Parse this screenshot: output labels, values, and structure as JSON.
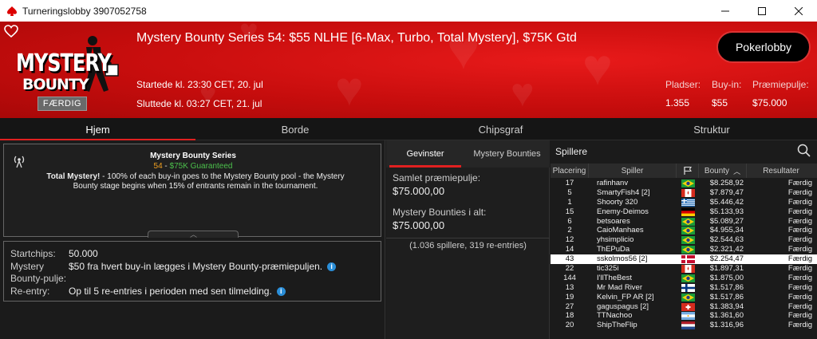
{
  "window": {
    "title": "Turneringslobby 3907052758"
  },
  "banner": {
    "logo_line1": "MYSTERY",
    "logo_line2": "BOUNTY",
    "status": "FÆRDIG",
    "title": "Mystery Bounty Series 54: $55 NLHE [6-Max, Turbo, Total Mystery], $75K Gtd",
    "started": "Startede kl. 23:30 CET, 20. jul",
    "ended": "Sluttede kl. 03:27 CET, 21. jul",
    "pokerlobby_label": "Pokerlobby",
    "stats": {
      "players_label": "Pladser:",
      "players_value": "1.355",
      "buyin_label": "Buy-in:",
      "buyin_value": "$55",
      "prize_label": "Præmiepulje:",
      "prize_value": "$75.000"
    }
  },
  "tabs": [
    {
      "label": "Hjem",
      "active": true
    },
    {
      "label": "Borde",
      "active": false
    },
    {
      "label": "Chipsgraf",
      "active": false
    },
    {
      "label": "Struktur",
      "active": false
    }
  ],
  "info": {
    "title": "Mystery Bounty Series",
    "sub_number": "54",
    "sub_sep": " - ",
    "sub_gtd": "$75K Guaranteed",
    "desc_bold": "Total Mystery!",
    "desc_rest": " - 100% of each buy-in goes to the Mystery Bounty pool - the Mystery Bounty stage begins when 15% of entrants remain in the tournament."
  },
  "details": [
    {
      "key": "Startchips:",
      "value": "50.000",
      "info": false
    },
    {
      "key": "Mystery Bounty-pulje:",
      "value": "$50 fra hvert buy-in lægges i Mystery Bounty-præmiepuljen.",
      "info": true
    },
    {
      "key": "Re-entry:",
      "value": "Op til 5 re-entries i perioden med sen tilmelding.",
      "info": true
    }
  ],
  "middle": {
    "tabs": [
      {
        "label": "Gevinster",
        "active": true
      },
      {
        "label": "Mystery Bounties",
        "active": false
      }
    ],
    "total_prize_label": "Samlet præmiepulje:",
    "total_prize_value": "$75.000,00",
    "mystery_label": "Mystery Bounties i alt:",
    "mystery_value": "$75.000,00",
    "note": "(1.036 spillere, 319 re-entries)"
  },
  "players": {
    "header": "Spillere",
    "columns": {
      "place": "Placering",
      "player": "Spiller",
      "bounty": "Bounty",
      "result": "Resultater"
    },
    "rows": [
      {
        "place": "17",
        "name": "rafinhanv",
        "flag": "br",
        "bounty": "$8.258,92",
        "result": "Færdig"
      },
      {
        "place": "5",
        "name": "SmartyFish4 [2]",
        "flag": "ca",
        "bounty": "$7.879,47",
        "result": "Færdig"
      },
      {
        "place": "1",
        "name": "Shoorty 320",
        "flag": "gr",
        "bounty": "$5.446,42",
        "result": "Færdig"
      },
      {
        "place": "15",
        "name": "Enemy-Deimos",
        "flag": "de",
        "bounty": "$5.133,93",
        "result": "Færdig"
      },
      {
        "place": "6",
        "name": "betsoares",
        "flag": "br",
        "bounty": "$5.089,27",
        "result": "Færdig"
      },
      {
        "place": "2",
        "name": "CaioManhaes",
        "flag": "br",
        "bounty": "$4.955,34",
        "result": "Færdig"
      },
      {
        "place": "12",
        "name": "yhsimplicio",
        "flag": "br",
        "bounty": "$2.544,63",
        "result": "Færdig"
      },
      {
        "place": "14",
        "name": "ThEPuDa",
        "flag": "br",
        "bounty": "$2.321,42",
        "result": "Færdig"
      },
      {
        "place": "43",
        "name": "sskolmos56 [2]",
        "flag": "dk",
        "bounty": "$2.254,47",
        "result": "Færdig",
        "highlight": true
      },
      {
        "place": "22",
        "name": "tic325i",
        "flag": "ca",
        "bounty": "$1.897,31",
        "result": "Færdig"
      },
      {
        "place": "144",
        "name": "I'llTheBest",
        "flag": "br",
        "bounty": "$1.875,00",
        "result": "Færdig"
      },
      {
        "place": "13",
        "name": "Mr Mad River",
        "flag": "fi",
        "bounty": "$1.517,86",
        "result": "Færdig"
      },
      {
        "place": "19",
        "name": "Kelvin_FP AR [2]",
        "flag": "br",
        "bounty": "$1.517,86",
        "result": "Færdig"
      },
      {
        "place": "27",
        "name": "gaguspagus [2]",
        "flag": "ch",
        "bounty": "$1.383,94",
        "result": "Færdig"
      },
      {
        "place": "18",
        "name": "TTNachoo",
        "flag": "ar",
        "bounty": "$1.361,60",
        "result": "Færdig"
      },
      {
        "place": "20",
        "name": "ShipTheFlip",
        "flag": "nl",
        "bounty": "$1.316,96",
        "result": "Færdig"
      }
    ]
  }
}
